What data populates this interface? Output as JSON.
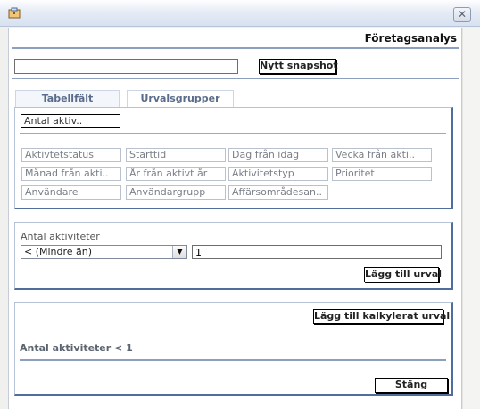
{
  "titlebar": {
    "close_glyph": "✕"
  },
  "header": {
    "title": "Företagsanalys"
  },
  "snapshot": {
    "input_value": "",
    "button_label": "Nytt snapshot"
  },
  "tabs": [
    {
      "label": "Tabellfält"
    },
    {
      "label": "Urvalsgrupper"
    }
  ],
  "fields_panel": {
    "selected_field": "Antal aktiv..",
    "items": [
      "Aktivtetstatus",
      "Starttid",
      "Dag från idag",
      "Vecka från akti..",
      "Månad från akti..",
      "År från aktivt år",
      "Aktivitetstyp",
      "Prioritet",
      "Användare",
      "Användargrupp",
      "Affärsområdesan.."
    ]
  },
  "filter_panel": {
    "label": "Antal aktiviteter",
    "operator_value": "< (Mindre än)",
    "value_input": "1",
    "add_button": "Lägg till urval"
  },
  "calc_panel": {
    "add_button": "Lägg till kalkylerat urval",
    "summary": "Antal aktiviteter < 1"
  },
  "close_button": "Stäng",
  "icons": {
    "app": "briefcase-icon",
    "close": "close-icon",
    "dropdown": "chevron-down-icon"
  },
  "colors": {
    "accent_line": "#8ca0be",
    "tab_text": "#5a6c8a",
    "panel_border": "#4f6e9c"
  }
}
